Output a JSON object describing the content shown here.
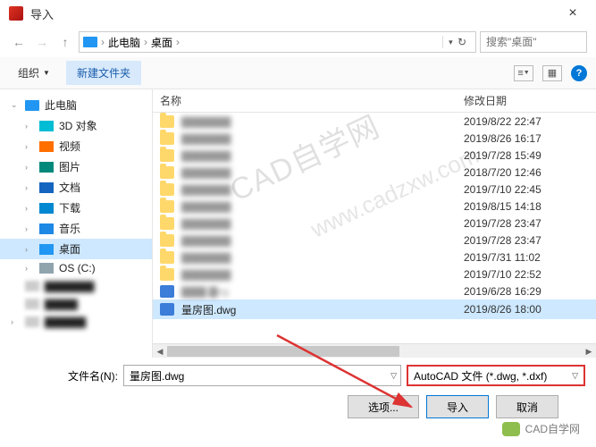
{
  "window": {
    "title": "导入"
  },
  "breadcrumb": {
    "pc": "此电脑",
    "desktop": "桌面"
  },
  "search": {
    "placeholder": "搜索\"桌面\""
  },
  "toolbar": {
    "organize": "组织",
    "newfolder": "新建文件夹"
  },
  "tree": {
    "pc": "此电脑",
    "items": [
      {
        "label": "3D 对象",
        "icon": "ic-3d"
      },
      {
        "label": "视频",
        "icon": "ic-vid"
      },
      {
        "label": "图片",
        "icon": "ic-img"
      },
      {
        "label": "文档",
        "icon": "ic-doc"
      },
      {
        "label": "下载",
        "icon": "ic-dl"
      },
      {
        "label": "音乐",
        "icon": "ic-mus"
      },
      {
        "label": "桌面",
        "icon": "ic-desk",
        "selected": true
      },
      {
        "label": "OS (C:)",
        "icon": "ic-drv"
      }
    ]
  },
  "columns": {
    "name": "名称",
    "date": "修改日期"
  },
  "files": [
    {
      "blur": true,
      "date": "2019/8/22 22:47"
    },
    {
      "blur": true,
      "date": "2019/8/26 16:17"
    },
    {
      "blur": true,
      "date": "2019/7/28 15:49"
    },
    {
      "blur": true,
      "date": "2018/7/20 12:46"
    },
    {
      "blur": true,
      "date": "2019/7/10 22:45"
    },
    {
      "blur": true,
      "date": "2019/8/15 14:18"
    },
    {
      "blur": true,
      "date": "2019/7/28 23:47"
    },
    {
      "blur": true,
      "date": "2019/7/28 23:47"
    },
    {
      "blur": true,
      "date": "2019/7/31 11:02"
    },
    {
      "blur": true,
      "date": "2019/7/10 22:52"
    },
    {
      "name": "▇▇▇.▇vg",
      "blur": true,
      "dwg": true,
      "date": "2019/6/28 16:29"
    },
    {
      "name": "量房图.dwg",
      "dwg": true,
      "selected": true,
      "date": "2019/8/26 18:00"
    }
  ],
  "filename": {
    "label": "文件名(N):",
    "value": "量房图.dwg"
  },
  "filetype": {
    "value": "AutoCAD 文件 (*.dwg, *.dxf)"
  },
  "buttons": {
    "options": "选项...",
    "import": "导入",
    "cancel": "取消"
  },
  "watermark": {
    "t1": "CAD自学网",
    "t2": "www.cadzxw.com"
  },
  "brand": "CAD自学网"
}
